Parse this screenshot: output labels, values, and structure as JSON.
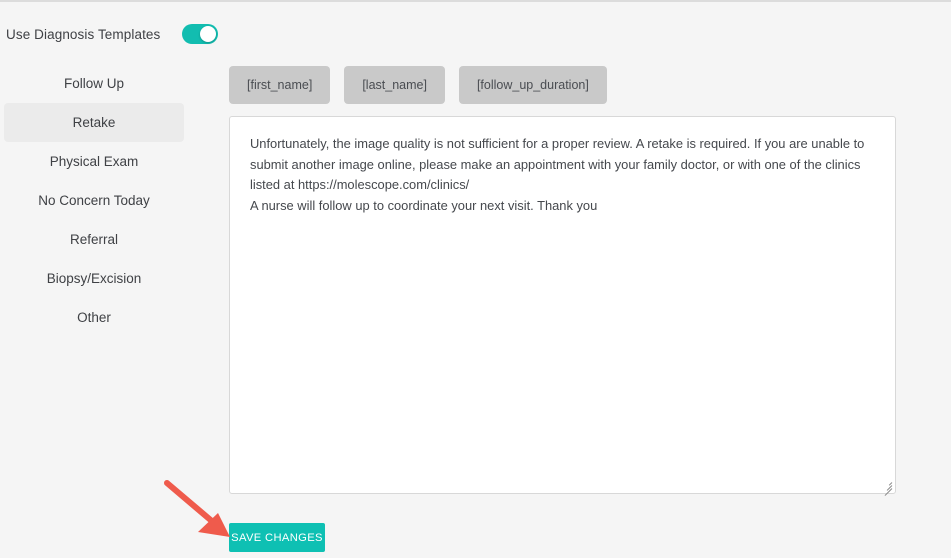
{
  "toggle": {
    "label": "Use Diagnosis Templates",
    "state": "on",
    "accent_color": "#12bdb0"
  },
  "sidebar": {
    "selected": "Retake",
    "items": [
      {
        "label": "Follow Up",
        "selected": false
      },
      {
        "label": "Retake",
        "selected": true
      },
      {
        "label": "Physical Exam",
        "selected": false
      },
      {
        "label": "No Concern Today",
        "selected": false
      },
      {
        "label": "Referral",
        "selected": false
      },
      {
        "label": "Biopsy/Excision",
        "selected": false
      },
      {
        "label": "Other",
        "selected": false
      }
    ]
  },
  "chips": {
    "items": [
      {
        "label": "[first_name]"
      },
      {
        "label": "[last_name]"
      },
      {
        "label": "[follow_up_duration]"
      }
    ],
    "background_color": "#c9c9c9"
  },
  "editor": {
    "value": "Unfortunately, the image quality is not sufficient for a proper review. A retake is required. If you are unable to submit another image online, please make an appointment with your family doctor, or with one of the clinics listed at https://molescope.com/clinics/\nA nurse will follow up to coordinate your next visit. Thank you",
    "placeholder": "",
    "has_cursor": true
  },
  "save_button": {
    "label": "SAVE CHANGES",
    "color": "#0ec0b3",
    "text_color": "#ffffff"
  },
  "annotation": {
    "arrow_color": "#ef5b4c",
    "points_to": "SAVE CHANGES"
  },
  "page": {
    "background_color": "#f5f5f5"
  }
}
